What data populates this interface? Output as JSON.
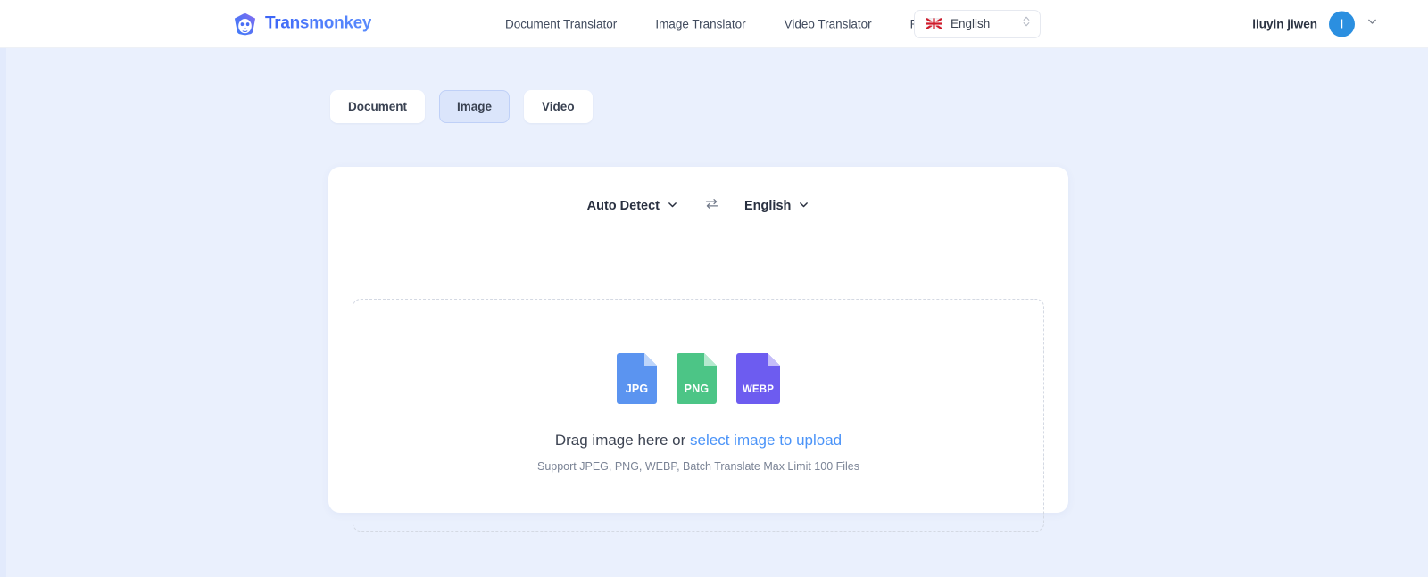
{
  "header": {
    "brand_name": "Transmonkey",
    "brand_logo_icon": "monkey-logo-icon",
    "nav": [
      {
        "label": "Document Translator"
      },
      {
        "label": "Image Translator"
      },
      {
        "label": "Video Translator"
      },
      {
        "label": "Pricing"
      }
    ],
    "language_selector": {
      "flag_icon": "uk-flag-icon",
      "value": "English",
      "chevron_icon": "up-down-chevron-icon"
    },
    "user": {
      "name": "liuyin jiwen",
      "avatar_initial": "l",
      "avatar_color": "#2b8fe0",
      "chevron_icon": "chevron-down-icon"
    }
  },
  "tabs": [
    {
      "label": "Document",
      "active": false
    },
    {
      "label": "Image",
      "active": true
    },
    {
      "label": "Video",
      "active": false
    }
  ],
  "card": {
    "source_language": {
      "label": "Auto Detect",
      "chevron_icon": "chevron-down-icon"
    },
    "swap_icon": "swap-arrows-icon",
    "target_language": {
      "label": "English",
      "chevron_icon": "chevron-down-icon"
    },
    "dropzone": {
      "file_types": [
        {
          "label": "JPG",
          "color": "#5b94f0"
        },
        {
          "label": "PNG",
          "color": "#4cc586"
        },
        {
          "label": "WEBP",
          "color": "#6d5cf0"
        }
      ],
      "prompt_prefix": "Drag image here or ",
      "prompt_link": "select image to upload",
      "support_text": "Support JPEG, PNG, WEBP, Batch Translate Max Limit 100 Files"
    }
  },
  "colors": {
    "page_background": "#eaf0fd",
    "card_background": "#ffffff",
    "accent_link": "#4a93f8",
    "tab_active_bg": "#dbe5fb",
    "tab_active_border": "#bfd0f7",
    "brand_gradient_start": "#3b63f6",
    "brand_gradient_end": "#5a8bfc"
  }
}
